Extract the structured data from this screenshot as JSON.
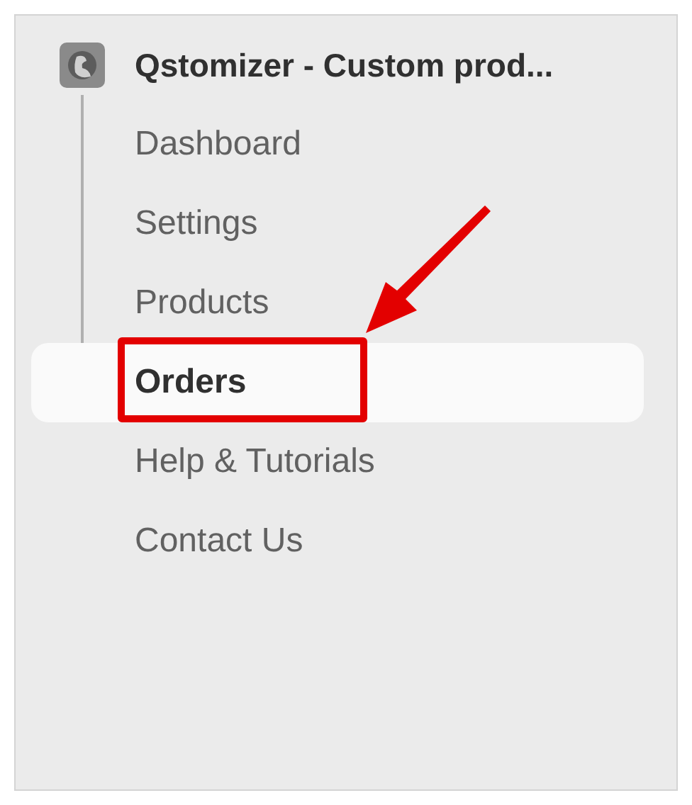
{
  "app": {
    "title": "Qstomizer - Custom prod..."
  },
  "nav_items": [
    {
      "label": "Dashboard",
      "selected": false
    },
    {
      "label": "Settings",
      "selected": false
    },
    {
      "label": "Products",
      "selected": false
    },
    {
      "label": "Orders",
      "selected": true
    },
    {
      "label": "Help & Tutorials",
      "selected": false
    },
    {
      "label": "Contact Us",
      "selected": false
    }
  ]
}
